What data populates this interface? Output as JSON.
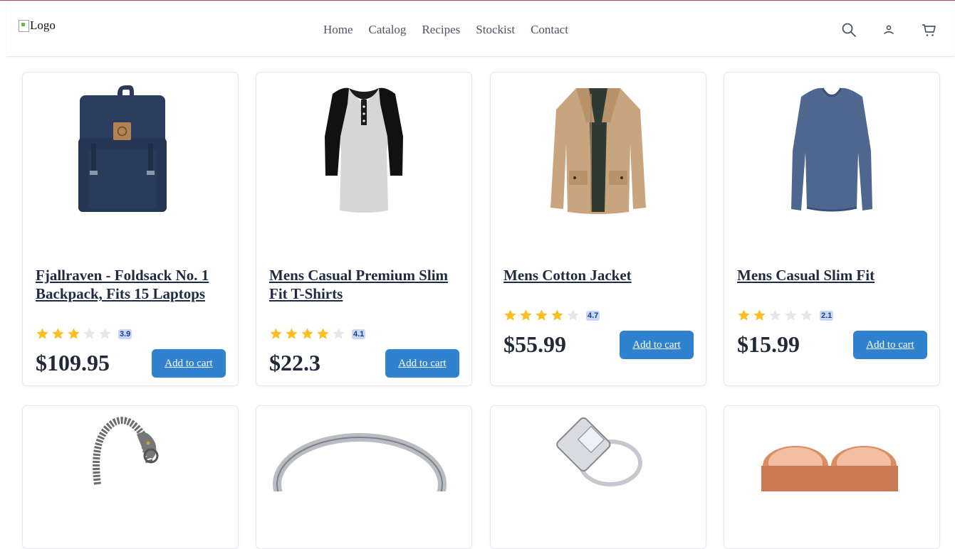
{
  "header": {
    "logo_alt": "Logo",
    "nav": [
      "Home",
      "Catalog",
      "Recipes",
      "Stockist",
      "Contact"
    ],
    "icons": [
      "search-icon",
      "user-icon",
      "cart-icon"
    ]
  },
  "products": [
    {
      "title": "Fjallraven - Foldsack No. 1 Backpack, Fits 15 Laptops",
      "rating": 3.9,
      "rating_label": "3.9",
      "price": "$109.95",
      "button": "Add to cart",
      "image": "backpack"
    },
    {
      "title": "Mens Casual Premium Slim Fit T-Shirts",
      "rating": 4.1,
      "rating_label": "4.1",
      "price": "$22.3",
      "button": "Add to cart",
      "image": "tshirt"
    },
    {
      "title": "Mens Cotton Jacket",
      "rating": 4.7,
      "rating_label": "4.7",
      "price": "$55.99",
      "button": "Add to cart",
      "image": "jacket"
    },
    {
      "title": "Mens Casual Slim Fit",
      "rating": 2.1,
      "rating_label": "2.1",
      "price": "$15.99",
      "button": "Add to cart",
      "image": "longsleeve"
    },
    {
      "image": "bracelet"
    },
    {
      "image": "ring"
    },
    {
      "image": "diamond-ring"
    },
    {
      "image": "rose-gold-rings"
    }
  ],
  "colors": {
    "accent": "#3182ce",
    "star": "#fbbf24",
    "star_empty": "#e5e7eb",
    "top_border": "#b4436e"
  }
}
